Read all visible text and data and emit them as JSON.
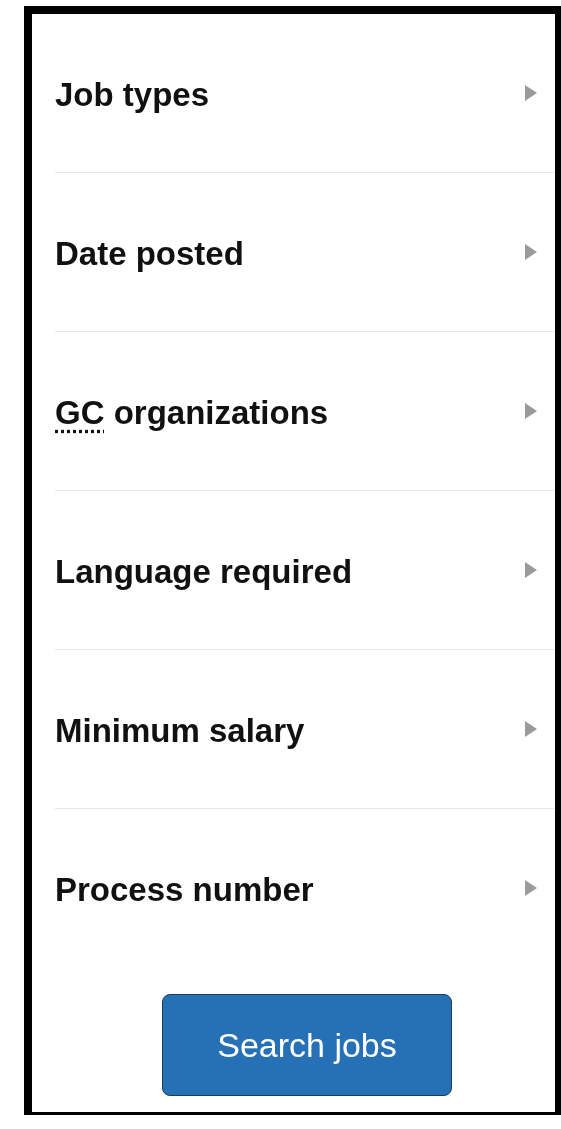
{
  "filters": [
    {
      "label": "Job types",
      "expanded": false
    },
    {
      "label": "Date posted",
      "expanded": false
    },
    {
      "abbr": "GC",
      "label": "organizations",
      "expanded": false
    },
    {
      "label": "Language required",
      "expanded": false
    },
    {
      "label": "Minimum salary",
      "expanded": false
    },
    {
      "label": "Process number",
      "expanded": false
    }
  ],
  "button": "Search jobs"
}
